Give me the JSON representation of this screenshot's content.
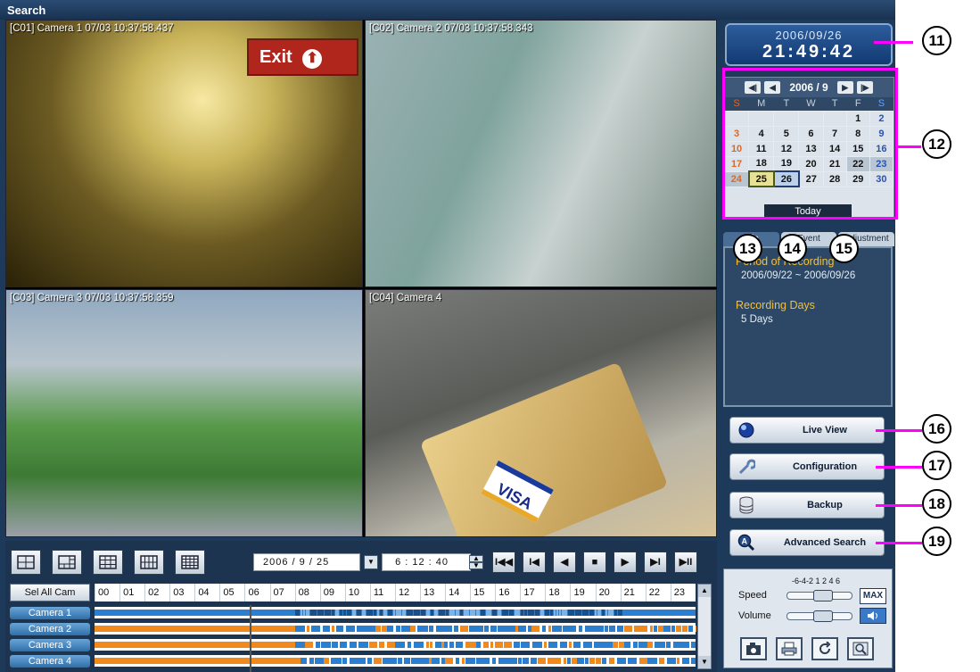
{
  "window": {
    "title": "Search"
  },
  "cameras": [
    {
      "label": "[C01] Camera 1 07/03 10:37:58.437",
      "exit_text": "Exit",
      "exit_arrow": "⬆"
    },
    {
      "label": "[C02] Camera 2 07/03 10:37:58.343"
    },
    {
      "label": "[C03] Camera 3 07/03 10:37:58.359"
    },
    {
      "label": "[C04] Camera 4",
      "card_text": "VISA"
    }
  ],
  "clock": {
    "date": "2006/09/26",
    "time": "21:49:42"
  },
  "calendar": {
    "month_label": "2006 / 9",
    "weekdays": [
      "S",
      "M",
      "T",
      "W",
      "T",
      "F",
      "S"
    ],
    "weeks": [
      [
        "",
        "",
        "",
        "",
        "",
        "1",
        "2"
      ],
      [
        "3",
        "4",
        "5",
        "6",
        "7",
        "8",
        "9"
      ],
      [
        "10",
        "11",
        "12",
        "13",
        "14",
        "15",
        "16"
      ],
      [
        "17",
        "18",
        "19",
        "20",
        "21",
        "22",
        "23"
      ],
      [
        "24",
        "25",
        "26",
        "27",
        "28",
        "29",
        "30"
      ]
    ],
    "recorded_days": [
      "22",
      "23",
      "24",
      "25",
      "26"
    ],
    "selected_day": "25",
    "current_day": "26",
    "today_label": "Today",
    "nav": [
      "◀|",
      "◀",
      "▶",
      "|▶"
    ]
  },
  "tabs": [
    "Info",
    "Event",
    "Adjustment"
  ],
  "info_panel": {
    "period_heading": "Period of Recording",
    "period_value": "2006/09/22 ~ 2006/09/26",
    "days_heading": "Recording Days",
    "days_value": "5 Days"
  },
  "buttons": {
    "live_view": "Live View",
    "configuration": "Configuration",
    "backup": "Backup",
    "advanced_search": "Advanced Search"
  },
  "control_panel": {
    "speed_scale": "-6-4-2 1 2 4 6",
    "speed_label": "Speed",
    "volume_label": "Volume",
    "max_label": "MAX",
    "speed_level": 0.55,
    "volume_level": 0.55
  },
  "timeline": {
    "date": {
      "year": "2006",
      "month": "9",
      "day": "25"
    },
    "time": {
      "hour": "6",
      "minute": "12",
      "second": "40"
    },
    "sel_all": "Sel All Cam",
    "hours": [
      "00",
      "01",
      "02",
      "03",
      "04",
      "05",
      "06",
      "07",
      "08",
      "09",
      "10",
      "11",
      "12",
      "13",
      "14",
      "15",
      "16",
      "17",
      "18",
      "19",
      "20",
      "21",
      "22",
      "23"
    ],
    "camera_rows": [
      "Camera 1",
      "Camera 2",
      "Camera 3",
      "Camera 4"
    ],
    "playhead_hour": 6.2,
    "playback": [
      "I◀◀",
      "I◀",
      "◀",
      "■",
      "▶",
      "▶I",
      "▶II"
    ]
  },
  "callouts": [
    "11",
    "12",
    "13",
    "14",
    "15",
    "16",
    "17",
    "18",
    "19"
  ],
  "colors": {
    "continuous_record": "#f08a1d",
    "motion_record": "#2b7fd0",
    "callout_line": "#ff00ff"
  }
}
